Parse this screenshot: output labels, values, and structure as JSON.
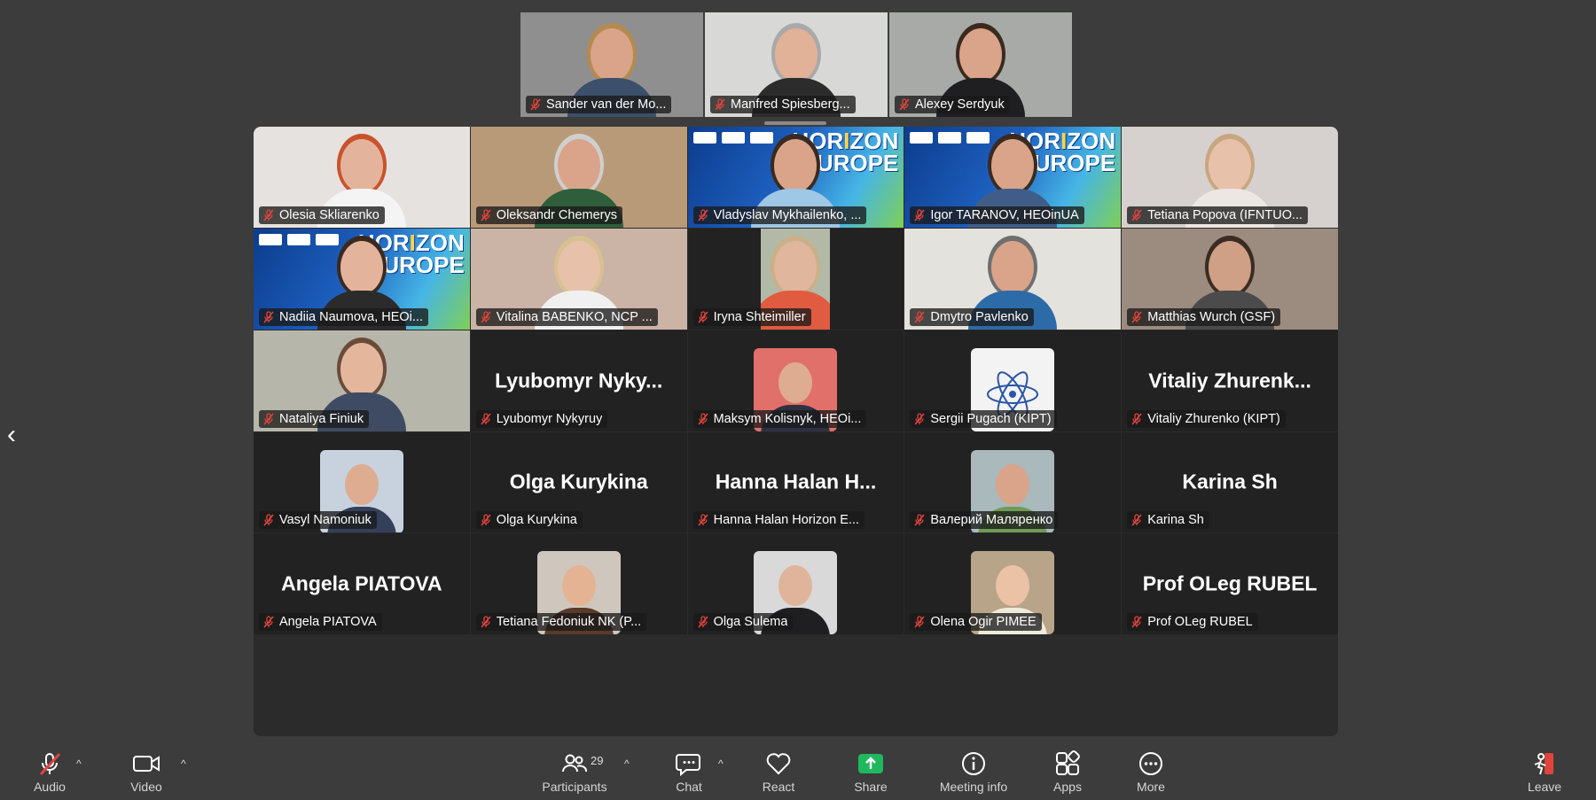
{
  "strip": [
    {
      "name": "Sander van der Mo..."
    },
    {
      "name": "Manfred Spiesberg..."
    },
    {
      "name": "Alexey Serdyuk",
      "active": true
    }
  ],
  "grid": [
    {
      "name": "Olesia Skliarenko",
      "kind": "video",
      "bg": "#e6e2df",
      "skin": "#e3b49b",
      "shirt": "#f4f4f4",
      "hair": "#c9532d"
    },
    {
      "name": "Oleksandr Chemerys",
      "kind": "video",
      "bg": "#b99a78",
      "skin": "#d9a489",
      "shirt": "#2e5e3a",
      "hair": "#cfcfcf"
    },
    {
      "name": "Vladyslav Mykhailenko, ...",
      "kind": "banner",
      "banner_text": "HORIZON\nEUROPE",
      "skin": "#d9a489",
      "shirt": "#9fc7e6"
    },
    {
      "name": "Igor TARANOV, HEOinUA",
      "kind": "banner",
      "banner_text": "HORIZON\nEUROPE",
      "skin": "#d9a489",
      "shirt": "#3f5d88"
    },
    {
      "name": "Tetiana Popova (IFNTUO...",
      "kind": "video",
      "bg": "#d6d1ce",
      "skin": "#e7c1aa",
      "shirt": "#ede7e3",
      "hair": "#c8a680"
    },
    {
      "name": "Nadiia Naumova, HEOi...",
      "kind": "banner",
      "banner_text": "HORIZON\nEUROPE",
      "skin": "#e3b49b",
      "shirt": "#2b2b2b"
    },
    {
      "name": "Vitalina BABENKO, NCP ...",
      "kind": "video",
      "bg": "#cbb3a5",
      "skin": "#e7c1aa",
      "shirt": "#f0f0f0",
      "hair": "#d8c190"
    },
    {
      "name": "Iryna Shteimiller",
      "kind": "narrow",
      "bg": "#b2b9a6",
      "skin": "#e0b69d",
      "shirt": "#e05b3f"
    },
    {
      "name": "Dmytro Pavlenko",
      "kind": "video",
      "bg": "#e4e2dd",
      "skin": "#d9a489",
      "shirt": "#2d6ba8",
      "hair": "#6f6f6f"
    },
    {
      "name": "Matthias Wurch (GSF)",
      "kind": "video",
      "bg": "#9c8b7f",
      "skin": "#cf9f86",
      "shirt": "#4b4b4b",
      "hair": "#3a2c22"
    },
    {
      "name": "Nataliya Finiuk",
      "kind": "video",
      "bg": "#b6b6aa",
      "skin": "#e4b79d",
      "shirt": "#3e4b63",
      "hair": "#6a4b3a"
    },
    {
      "name": "Lyubomyr Nykyruy",
      "kind": "text",
      "big": "Lyubomyr Nyky..."
    },
    {
      "name": "Maksym Kolisnyk, HEOi...",
      "kind": "avatar",
      "bg": "#e1706a",
      "skin": "#deac90",
      "shirt": "#2e3140"
    },
    {
      "name": "Sergii Pugach (KIPT)",
      "kind": "logo",
      "bg": "#f3f3f3"
    },
    {
      "name": "Vitaliy Zhurenko (KIPT)",
      "kind": "text",
      "big": "Vitaliy Zhurenk..."
    },
    {
      "name": "Vasyl Namoniuk",
      "kind": "avatar",
      "bg": "#c8d2df",
      "skin": "#deac90",
      "shirt": "#34405a"
    },
    {
      "name": "Olga Kurykina",
      "kind": "text",
      "big": "Olga Kurykina"
    },
    {
      "name": "Hanna Halan Horizon E...",
      "kind": "text",
      "big": "Hanna Halan H..."
    },
    {
      "name": "Валерий Маляренко",
      "kind": "avatar",
      "bg": "#a9b9bc",
      "skin": "#d9a489",
      "shirt": "#6f9a57"
    },
    {
      "name": "Karina Sh",
      "kind": "text",
      "big": "Karina Sh"
    },
    {
      "name": "Angela PIATOVA",
      "kind": "text",
      "big": "Angela PIATOVA"
    },
    {
      "name": "Tetiana Fedoniuk NK (P...",
      "kind": "avatar",
      "bg": "#cfc6bd",
      "skin": "#e4b393",
      "shirt": "#5a3a28"
    },
    {
      "name": "Olga Sulema",
      "kind": "avatar",
      "bg": "#d9d9d9",
      "skin": "#e0b49a",
      "shirt": "#1f1f22"
    },
    {
      "name": "Olena Ogir PIMEE",
      "kind": "avatar",
      "bg": "#b7a489",
      "skin": "#ebc2a5",
      "shirt": "#f0ead9"
    },
    {
      "name": "Prof OLeg RUBEL",
      "kind": "text",
      "big": "Prof OLeg RUBEL"
    }
  ],
  "toolbar": {
    "audio": "Audio",
    "video": "Video",
    "participants": "Participants",
    "participants_count": "29",
    "chat": "Chat",
    "react": "React",
    "share": "Share",
    "meeting_info": "Meeting info",
    "apps": "Apps",
    "more": "More",
    "leave": "Leave"
  },
  "colors": {
    "active_speaker": "#2bd67b",
    "share_green": "#1fb85d",
    "mic_muted": "#e0443c"
  },
  "icons": [
    "mic-muted-icon",
    "video-icon",
    "participants-icon",
    "chat-icon",
    "react-icon",
    "share-icon",
    "info-icon",
    "apps-icon",
    "more-icon",
    "leave-icon",
    "chevron-left-icon",
    "caret-up-icon"
  ]
}
